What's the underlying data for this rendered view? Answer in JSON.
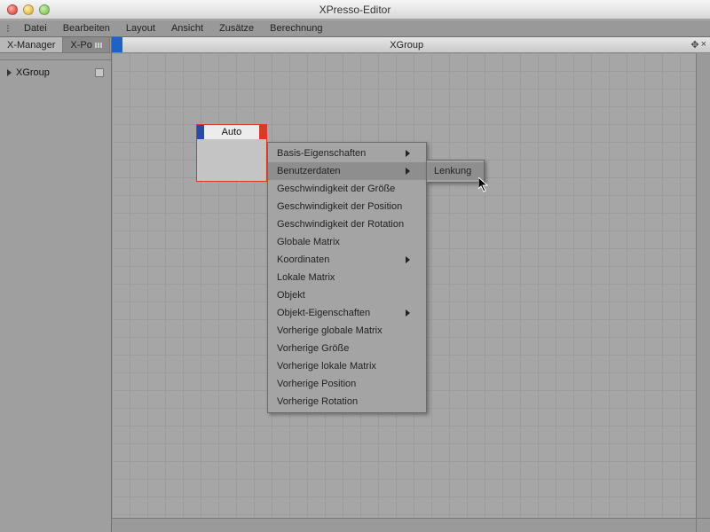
{
  "window": {
    "title": "XPresso-Editor"
  },
  "menubar": [
    "Datei",
    "Bearbeiten",
    "Layout",
    "Ansicht",
    "Zusätze",
    "Berechnung"
  ],
  "sidebar": {
    "tabs": [
      {
        "label": "X-Manager",
        "active": true
      },
      {
        "label": "X-Po",
        "active": false
      }
    ],
    "tree": [
      {
        "label": "XGroup"
      }
    ]
  },
  "canvas": {
    "title": "XGroup",
    "node": {
      "name": "Auto"
    }
  },
  "context_menu": {
    "items": [
      {
        "label": "Basis-Eigenschaften",
        "submenu": true
      },
      {
        "label": "Benutzerdaten",
        "submenu": true,
        "highlighted": true
      },
      {
        "label": "Geschwindigkeit der Größe"
      },
      {
        "label": "Geschwindigkeit der Position"
      },
      {
        "label": "Geschwindigkeit der Rotation"
      },
      {
        "label": "Globale Matrix"
      },
      {
        "label": "Koordinaten",
        "submenu": true
      },
      {
        "label": "Lokale Matrix"
      },
      {
        "label": "Objekt"
      },
      {
        "label": "Objekt-Eigenschaften",
        "submenu": true
      },
      {
        "label": "Vorherige globale Matrix"
      },
      {
        "label": "Vorherige Größe"
      },
      {
        "label": "Vorherige lokale Matrix"
      },
      {
        "label": "Vorherige Position"
      },
      {
        "label": "Vorherige Rotation"
      }
    ],
    "flyout": [
      {
        "label": "Lenkung",
        "highlighted": true
      }
    ]
  }
}
